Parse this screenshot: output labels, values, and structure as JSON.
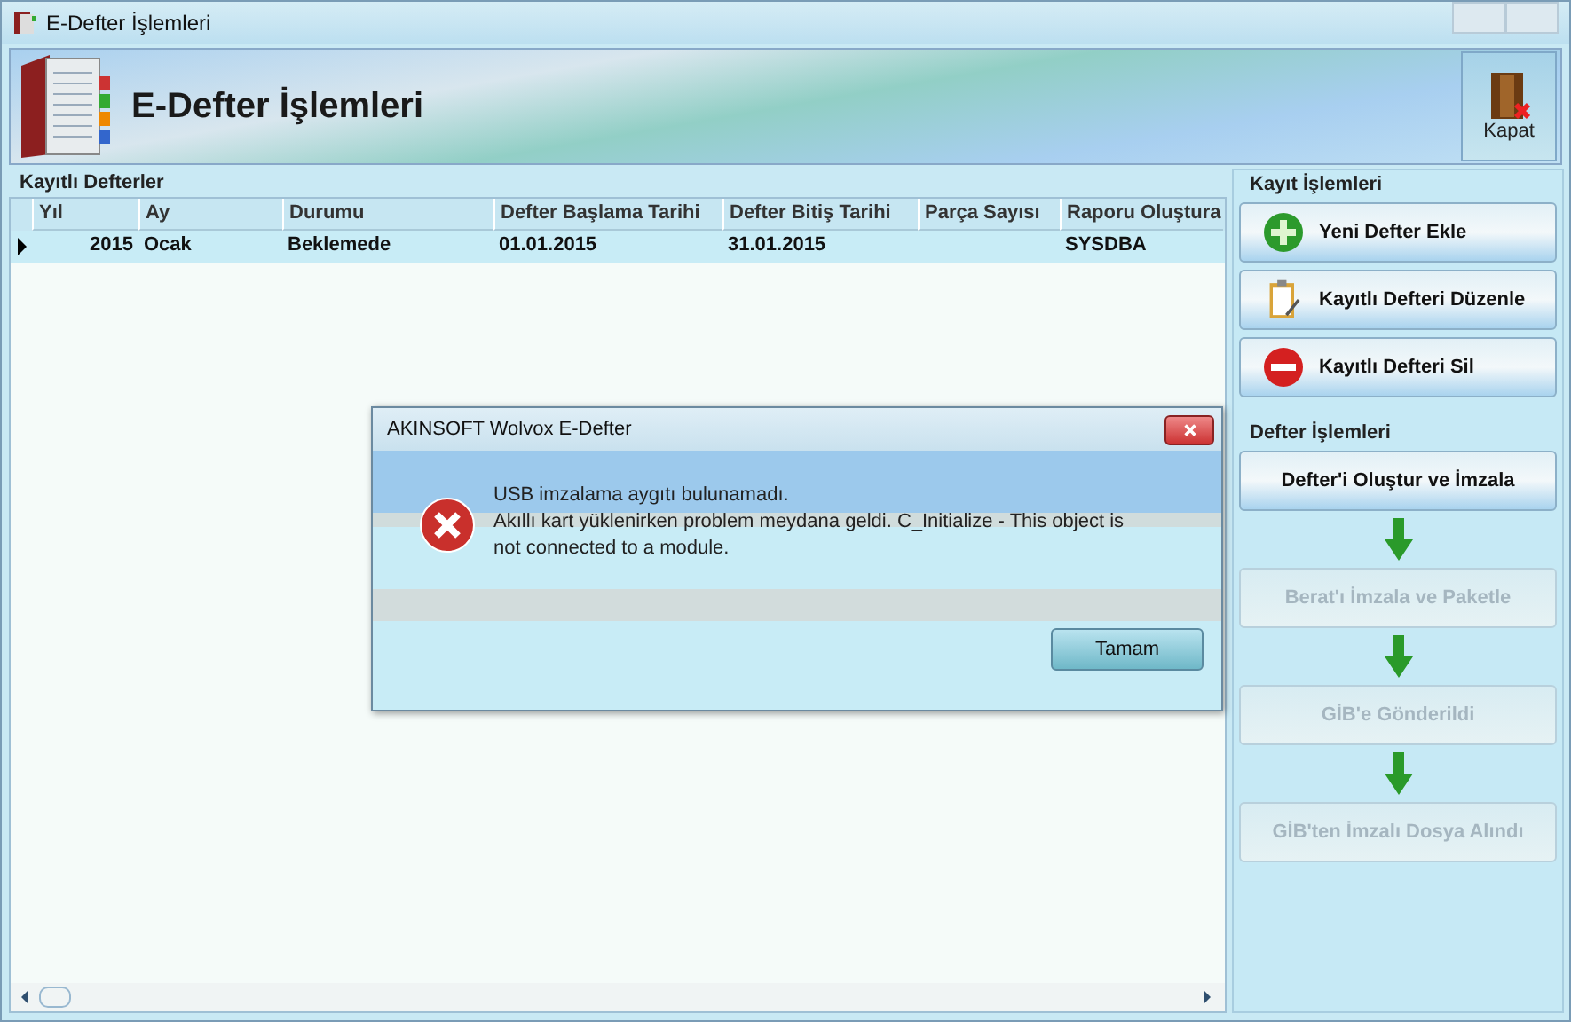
{
  "window": {
    "title": "E-Defter İşlemleri"
  },
  "header": {
    "title": "E-Defter İşlemleri",
    "close_button": "Kapat"
  },
  "records": {
    "title": "Kayıtlı Defterler",
    "columns": [
      "Yıl",
      "Ay",
      "Durumu",
      "Defter Başlama Tarihi",
      "Defter Bitiş Tarihi",
      "Parça Sayısı",
      "Raporu Oluştura"
    ],
    "rows": [
      {
        "selected": true,
        "cells": [
          "2015",
          "Ocak",
          "Beklemede",
          "01.01.2015",
          "31.01.2015",
          "",
          "SYSDBA"
        ]
      }
    ]
  },
  "record_actions": {
    "title": "Kayıt İşlemleri",
    "buttons": [
      {
        "label": "Yeni Defter Ekle",
        "kind": "add"
      },
      {
        "label": "Kayıtlı Defteri Düzenle",
        "kind": "edit"
      },
      {
        "label": "Kayıtlı Defteri Sil",
        "kind": "delete"
      }
    ]
  },
  "ledger_actions": {
    "title": "Defter İşlemleri",
    "steps": [
      {
        "label": "Defter'i Oluştur ve İmzala",
        "disabled": false
      },
      {
        "label": "Berat'ı İmzala ve Paketle",
        "disabled": true
      },
      {
        "label": "GİB'e Gönderildi",
        "disabled": true
      },
      {
        "label": "GİB'ten İmzalı Dosya Alındı",
        "disabled": true
      }
    ]
  },
  "dialog": {
    "title": "AKINSOFT Wolvox E-Defter",
    "message_lines": [
      "USB imzalama aygıtı bulunamadı.",
      "Akıllı kart yüklenirken problem meydana geldi. C_Initialize - This object is not connected to a module."
    ],
    "button": "Tamam"
  }
}
